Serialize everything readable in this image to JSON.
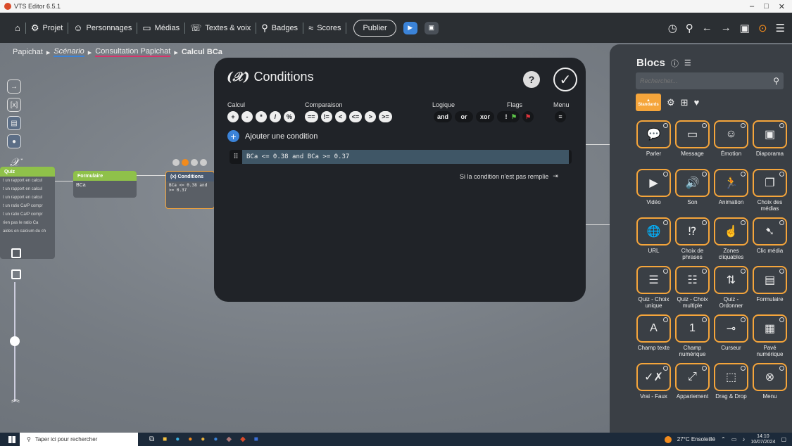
{
  "window": {
    "title": "VTS Editor 6.5.1",
    "min": "–",
    "max": "□",
    "close": "✕"
  },
  "toolbar": {
    "projet": "Projet",
    "personnages": "Personnages",
    "medias": "Médias",
    "textes_voix": "Textes & voix",
    "badges": "Badges",
    "scores": "Scores",
    "publier": "Publier"
  },
  "breadcrumb": [
    "Papichat",
    "Scénario",
    "Consultation Papichat",
    "Calcul BCa"
  ],
  "nodes": {
    "quiz": {
      "title": "Quiz",
      "rows": [
        "t un rapport en calcul",
        "t un rapport en calcul",
        "t un rapport en calcul",
        "t un ratio Ca/P compr",
        "t un ratio Ca/P compr",
        "rien pas le ratio Ca",
        "aides en calcium du ch"
      ]
    },
    "formulaire": {
      "title": "Formulaire",
      "sub": "BCa"
    },
    "condition": {
      "title": "(x) Conditions",
      "line1": "BCa <= 0.38 and",
      "line2": ">= 0.37"
    }
  },
  "dialog": {
    "fx": "(𝒳)",
    "title": "Conditions",
    "help": "?",
    "groups": {
      "calcul": {
        "label": "Calcul",
        "ops": [
          "+",
          "-",
          "*",
          "/",
          "%"
        ]
      },
      "comparaison": {
        "label": "Comparaison",
        "ops": [
          "==",
          "!=",
          "<",
          "<=",
          ">",
          ">="
        ]
      },
      "logique": {
        "label": "Logique",
        "ops": [
          "and",
          "or",
          "xor",
          "!"
        ]
      },
      "flags": {
        "label": "Flags"
      },
      "menu": {
        "label": "Menu"
      }
    },
    "add_condition": "Ajouter une condition",
    "condition_expr": "BCa <= 0.38 and BCa >= 0.37",
    "else_label": "Si la condition n'est pas remplie"
  },
  "panel": {
    "title": "Blocs",
    "search_placeholder": "Rechercher...",
    "category_active": "Standards",
    "blocks": [
      {
        "label": "Parler",
        "icon": "speech-bubble-icon",
        "glyph": "💬"
      },
      {
        "label": "Message",
        "icon": "message-icon",
        "glyph": "▭"
      },
      {
        "label": "Émotion",
        "icon": "emotion-icon",
        "glyph": "☺"
      },
      {
        "label": "Diaporama",
        "icon": "slideshow-icon",
        "glyph": "▣"
      },
      {
        "label": "Vidéo",
        "icon": "video-icon",
        "glyph": "▶"
      },
      {
        "label": "Son",
        "icon": "sound-icon",
        "glyph": "🔊"
      },
      {
        "label": "Animation",
        "icon": "animation-icon",
        "glyph": "🏃"
      },
      {
        "label": "Choix des médias",
        "icon": "media-choice-icon",
        "glyph": "❐"
      },
      {
        "label": "URL",
        "icon": "url-icon",
        "glyph": "🌐"
      },
      {
        "label": "Choix de phrases",
        "icon": "phrase-choice-icon",
        "glyph": "⁉"
      },
      {
        "label": "Zones cliquables",
        "icon": "clickable-zones-icon",
        "glyph": "☝"
      },
      {
        "label": "Clic média",
        "icon": "media-click-icon",
        "glyph": "➷"
      },
      {
        "label": "Quiz - Choix unique",
        "icon": "single-choice-icon",
        "glyph": "☰"
      },
      {
        "label": "Quiz - Choix multiple",
        "icon": "multiple-choice-icon",
        "glyph": "☷"
      },
      {
        "label": "Quiz - Ordonner",
        "icon": "order-icon",
        "glyph": "⇅"
      },
      {
        "label": "Formulaire",
        "icon": "form-icon",
        "glyph": "▤"
      },
      {
        "label": "Champ texte",
        "icon": "text-field-icon",
        "glyph": "A"
      },
      {
        "label": "Champ numérique",
        "icon": "number-field-icon",
        "glyph": "1"
      },
      {
        "label": "Curseur",
        "icon": "slider-icon",
        "glyph": "⊸"
      },
      {
        "label": "Pavé numérique",
        "icon": "keypad-icon",
        "glyph": "▦"
      },
      {
        "label": "Vrai - Faux",
        "icon": "true-false-icon",
        "glyph": "✓✗"
      },
      {
        "label": "Appariement",
        "icon": "matching-icon",
        "glyph": "⤢"
      },
      {
        "label": "Drag & Drop",
        "icon": "drag-drop-icon",
        "glyph": "⬚"
      },
      {
        "label": "Menu",
        "icon": "menu-icon",
        "glyph": "⊗"
      }
    ]
  },
  "taskbar": {
    "search_placeholder": "Taper ici pour rechercher",
    "weather": "27°C  Ensoleillé",
    "time": "14:10",
    "date": "10/07/2024"
  },
  "colors": {
    "accent": "#f5a53b",
    "blue": "#3b83d8",
    "pink": "#d8346b",
    "green": "#8fc14a"
  }
}
